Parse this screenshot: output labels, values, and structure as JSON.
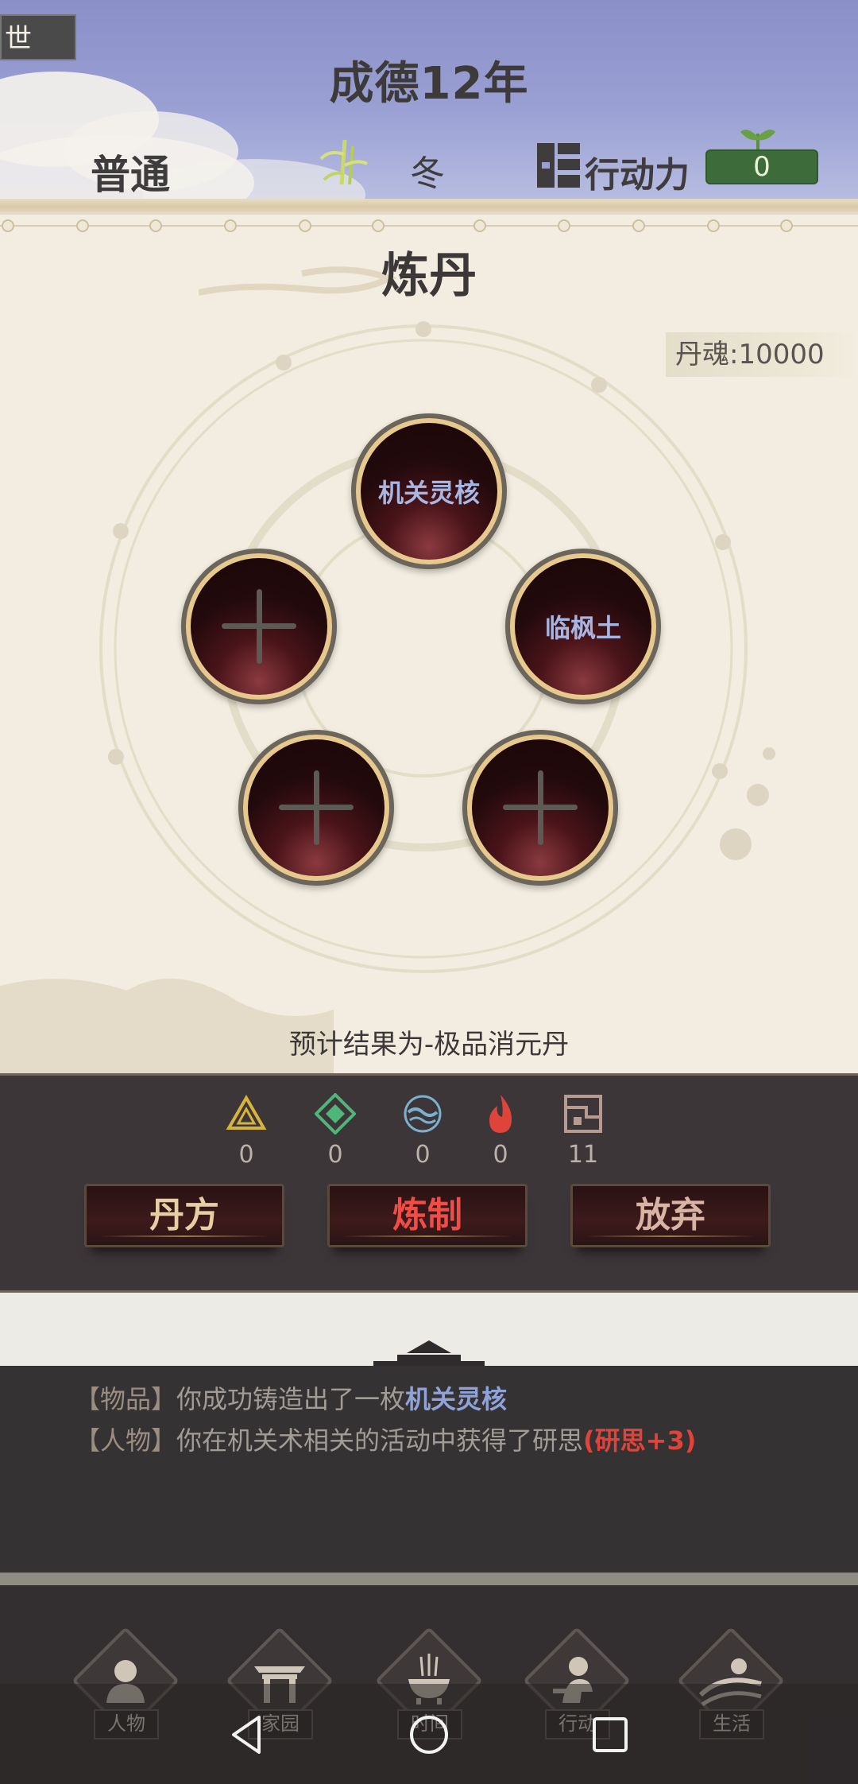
{
  "header": {
    "corner_tab": "世",
    "year_title": "成德12年",
    "difficulty": "普通",
    "season": "冬",
    "action_label": "行动力",
    "action_value": "0",
    "icons": [
      "bamboo-icon",
      "action-points-icon",
      "sprout-icon"
    ]
  },
  "panel": {
    "title": "炼丹",
    "dan_soul": "丹魂:10000",
    "slots": [
      {
        "label": "机关灵核",
        "filled": true
      },
      {
        "label": "",
        "filled": false
      },
      {
        "label": "临枫土",
        "filled": true
      },
      {
        "label": "",
        "filled": false
      },
      {
        "label": "",
        "filled": false
      }
    ],
    "forecast": "预计结果为-极品消元丹"
  },
  "elements": [
    {
      "icon": "triangle-element-icon",
      "count": "0",
      "color": "#d7b33a"
    },
    {
      "icon": "diamond-element-icon",
      "count": "0",
      "color": "#4fb679"
    },
    {
      "icon": "water-element-icon",
      "count": "0",
      "color": "#7cb0cf"
    },
    {
      "icon": "fire-element-icon",
      "count": "0",
      "color": "#e0433a"
    },
    {
      "icon": "metal-element-icon",
      "count": "11",
      "color": "#b79b91"
    }
  ],
  "buttons": {
    "recipe": "丹方",
    "refine": "炼制",
    "abandon": "放弃"
  },
  "log": [
    {
      "tag": "【物品】",
      "text": "你成功铸造出了一枚",
      "highlight": "机关灵核",
      "highlight_color": "#8fa3d8"
    },
    {
      "tag": "【人物】",
      "text": "你在机关术相关的活动中获得了研思",
      "highlight": "(研思+3)",
      "highlight_color": "#e0433a"
    }
  ],
  "nav": {
    "items": [
      {
        "label": "人物",
        "icon": "person-icon"
      },
      {
        "label": "家园",
        "icon": "gate-icon"
      },
      {
        "label": "时间",
        "icon": "incense-burner-icon"
      },
      {
        "label": "行动",
        "icon": "working-person-icon"
      },
      {
        "label": "生活",
        "icon": "landscape-icon"
      }
    ]
  }
}
